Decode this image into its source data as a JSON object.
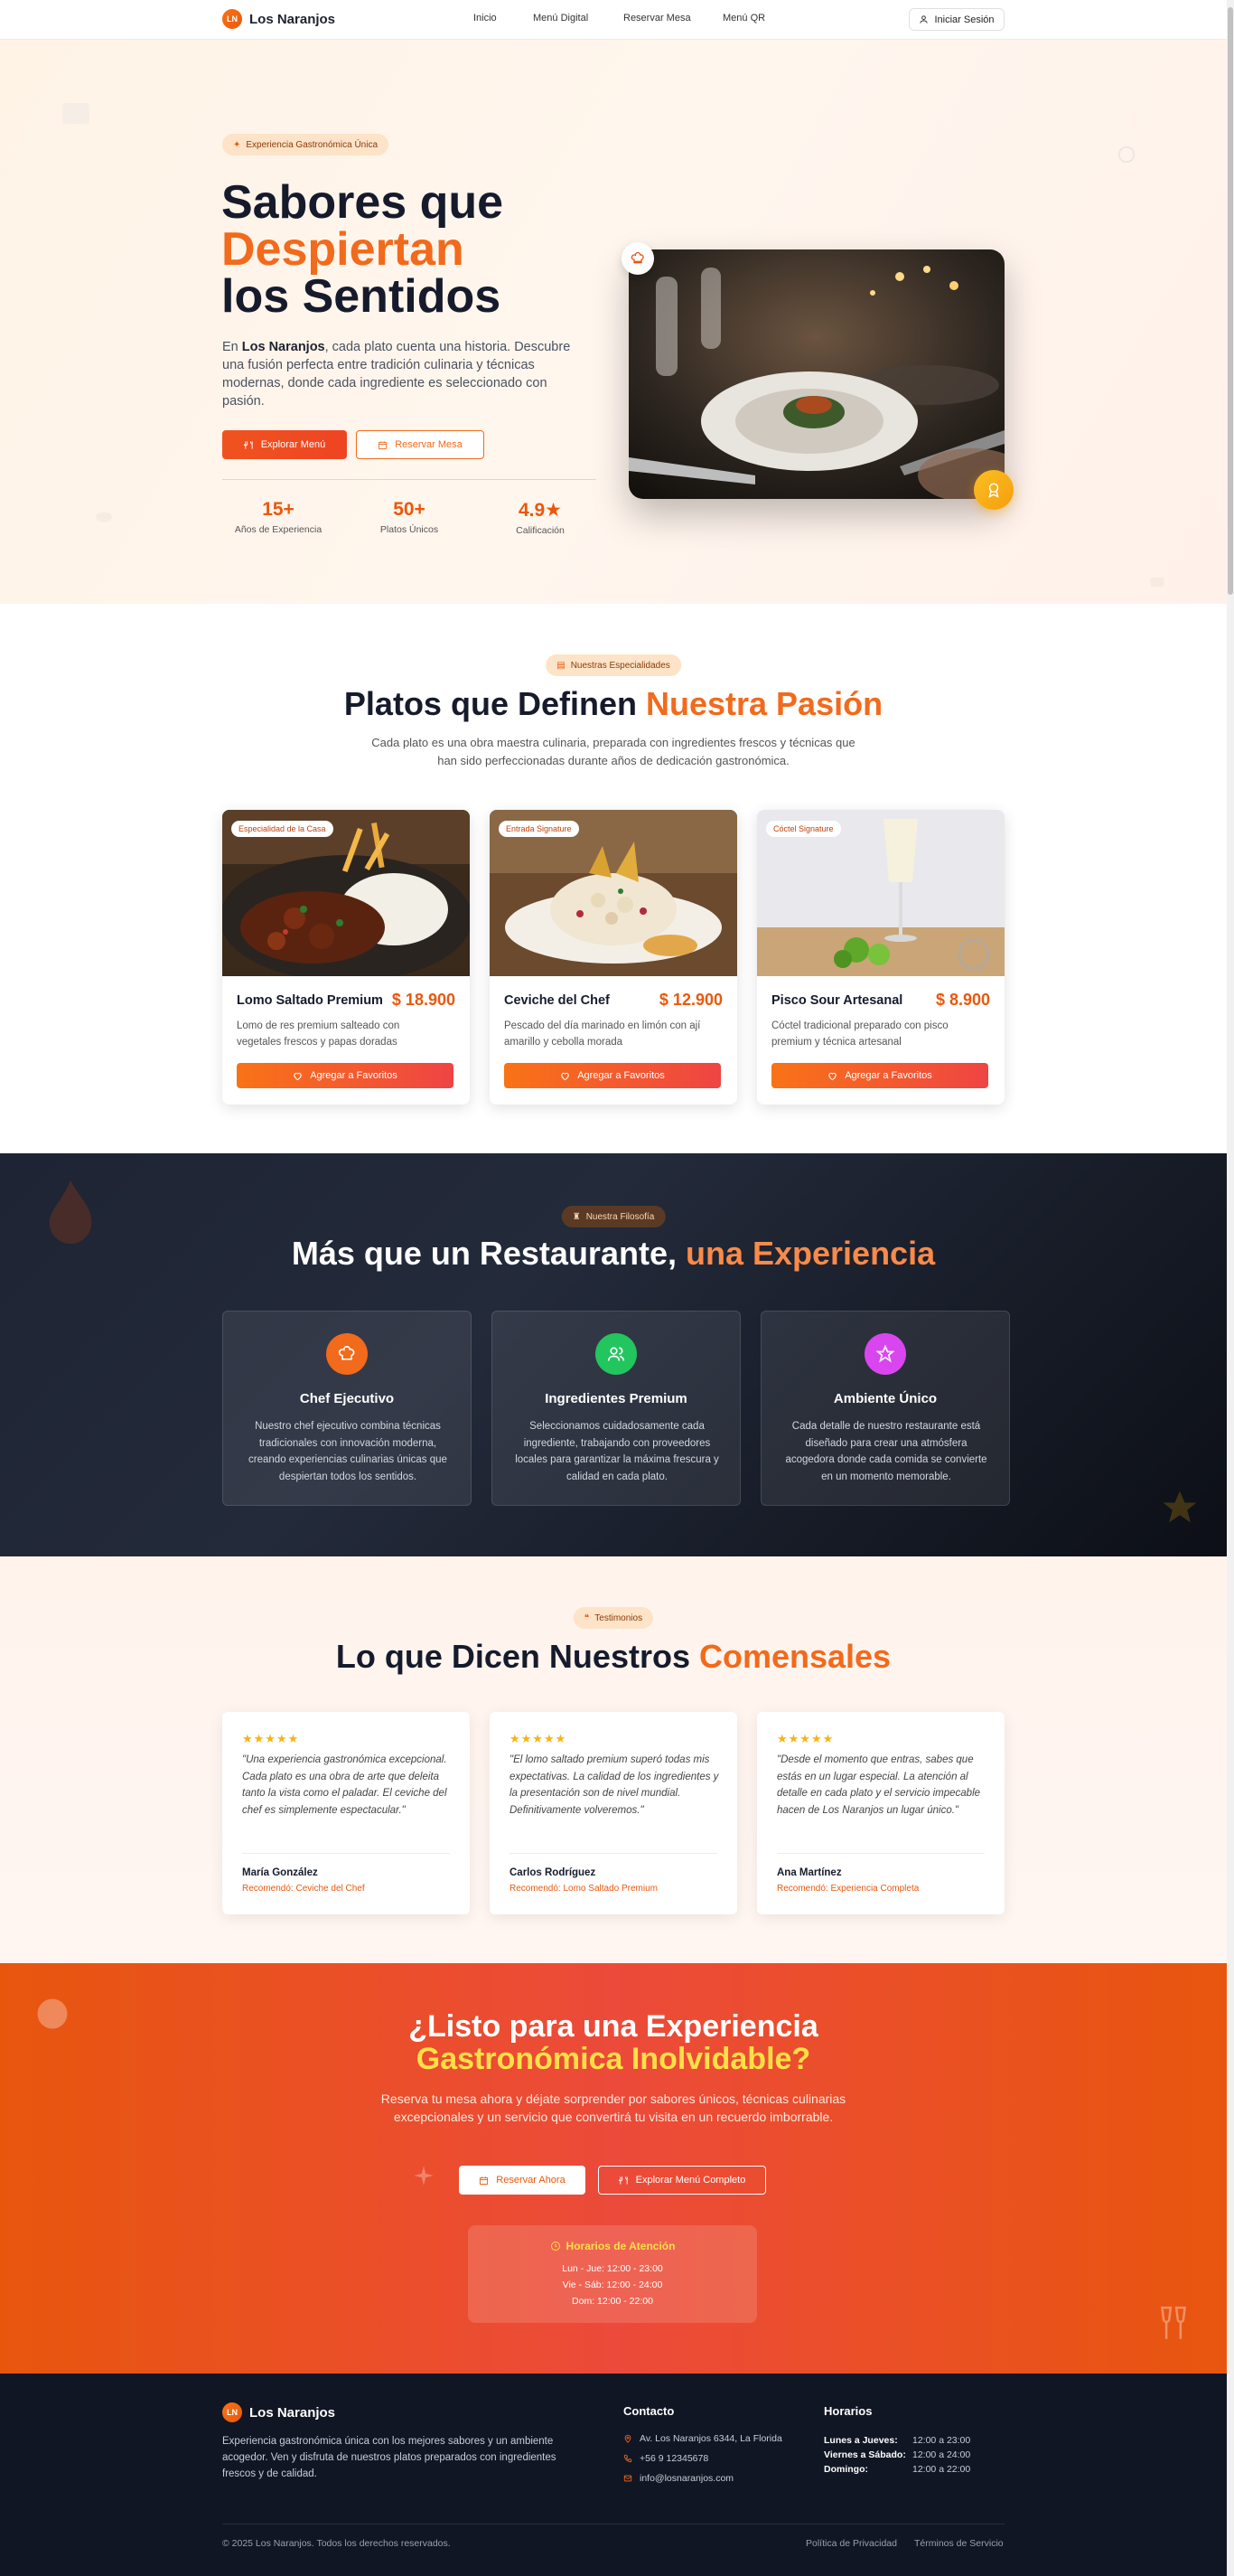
{
  "nav": {
    "logo_initials": "LN",
    "brand": "Los Naranjos",
    "links": [
      "Inicio",
      "Menú Digital",
      "Reservar Mesa",
      "Menú QR"
    ],
    "login": "Iniciar Sesión"
  },
  "hero": {
    "badge": "Experiencia Gastronómica Única",
    "title_line1": "Sabores que",
    "title_line2": "Despiertan",
    "title_line3": "los Sentidos",
    "desc_prefix": "En ",
    "desc_brand": "Los Naranjos",
    "desc_rest": ", cada plato cuenta una historia. Descubre una fusión perfecta entre tradición culinaria y técnicas modernas, donde cada ingrediente es seleccionado con pasión.",
    "btn_menu": "Explorar Menú",
    "btn_reserve": "Reservar Mesa",
    "stats": [
      {
        "num": "15+",
        "label": "Años de Experiencia"
      },
      {
        "num": "50+",
        "label": "Platos Únicos"
      },
      {
        "num": "4.9★",
        "label": "Calificación"
      }
    ]
  },
  "specialties": {
    "badge": "Nuestras Especialidades",
    "title_main": "Platos que Definen ",
    "title_accent": "Nuestra Pasión",
    "subtitle": "Cada plato es una obra maestra culinaria, preparada con ingredientes frescos y técnicas que han sido perfeccionadas durante años de dedicación gastronómica.",
    "dishes": [
      {
        "tag": "Especialidad de la Casa",
        "name": "Lomo Saltado Premium",
        "price": "$ 18.900",
        "desc": "Lomo de res premium salteado con vegetales frescos y papas doradas",
        "button": "Agregar a Favoritos"
      },
      {
        "tag": "Entrada Signature",
        "name": "Ceviche del Chef",
        "price": "$ 12.900",
        "desc": "Pescado del día marinado en limón con ají amarillo y cebolla morada",
        "button": "Agregar a Favoritos"
      },
      {
        "tag": "Cóctel Signature",
        "name": "Pisco Sour Artesanal",
        "price": "$ 8.900",
        "desc": "Cóctel tradicional preparado con pisco premium y técnica artesanal",
        "button": "Agregar a Favoritos"
      }
    ]
  },
  "philosophy": {
    "badge": "Nuestra Filosofía",
    "title_main": "Más que un Restaurante, ",
    "title_accent": "una Experiencia",
    "cards": [
      {
        "icon": "chef-hat-icon",
        "color": "#f26a1b",
        "title": "Chef Ejecutivo",
        "text": "Nuestro chef ejecutivo combina técnicas tradicionales con innovación moderna, creando experiencias culinarias únicas que despiertan todos los sentidos."
      },
      {
        "icon": "users-icon",
        "color": "#22c55e",
        "title": "Ingredientes Premium",
        "text": "Seleccionamos cuidadosamente cada ingrediente, trabajando con proveedores locales para garantizar la máxima frescura y calidad en cada plato."
      },
      {
        "icon": "star-icon",
        "color": "#d946ef",
        "title": "Ambiente Único",
        "text": "Cada detalle de nuestro restaurante está diseñado para crear una atmósfera acogedora donde cada comida se convierte en un momento memorable."
      }
    ]
  },
  "testimonials": {
    "badge": "Testimonios",
    "title_main": "Lo que Dicen Nuestros ",
    "title_accent": "Comensales",
    "stars": "★★★★★",
    "items": [
      {
        "quote": "\"Una experiencia gastronómica excepcional. Cada plato es una obra de arte que deleita tanto la vista como el paladar. El ceviche del chef es simplemente espectacular.\"",
        "name": "María González",
        "rec": "Recomendó: Ceviche del Chef"
      },
      {
        "quote": "\"El lomo saltado premium superó todas mis expectativas. La calidad de los ingredientes y la presentación son de nivel mundial. Definitivamente volveremos.\"",
        "name": "Carlos Rodríguez",
        "rec": "Recomendó: Lomo Saltado Premium"
      },
      {
        "quote": "\"Desde el momento que entras, sabes que estás en un lugar especial. La atención al detalle en cada plato y el servicio impecable hacen de Los Naranjos un lugar único.\"",
        "name": "Ana Martínez",
        "rec": "Recomendó: Experiencia Completa"
      }
    ]
  },
  "cta": {
    "title_line1": "¿Listo para una Experiencia",
    "title_line2": "Gastronómica Inolvidable?",
    "subtitle": "Reserva tu mesa ahora y déjate sorprender por sabores únicos, técnicas culinarias excepcionales y un servicio que convertirá tu visita en un recuerdo imborrable.",
    "btn_reserve": "Reservar Ahora",
    "btn_menu": "Explorar Menú Completo",
    "hours_title": "Horarios de Atención",
    "hours": [
      "Lun - Jue: 12:00 - 23:00",
      "Vie - Sáb: 12:00 - 24:00",
      "Dom: 12:00 - 22:00"
    ]
  },
  "footer": {
    "logo_initials": "LN",
    "brand": "Los Naranjos",
    "desc": "Experiencia gastronómica única con los mejores sabores y un ambiente acogedor. Ven y disfruta de nuestros platos preparados con ingredientes frescos y de calidad.",
    "contact_title": "Contacto",
    "address": "Av. Los Naranjos 6344, La Florida",
    "phone": "+56 9 12345678",
    "email": "info@losnaranjos.com",
    "hours_title": "Horarios",
    "hours": [
      {
        "day": "Lunes a Jueves:",
        "time": "12:00 a 23:00"
      },
      {
        "day": "Viernes a Sábado:",
        "time": "12:00 a 24:00"
      },
      {
        "day": "Domingo:",
        "time": "12:00 a 22:00"
      }
    ],
    "copyright": "© 2025 Los Naranjos. Todos los derechos reservados.",
    "privacy": "Política de Privacidad",
    "terms": "Términos de Servicio"
  },
  "colors": {
    "accent": "#f26a1b",
    "dark": "#161b2c",
    "cta": "#e8560e",
    "gold": "#fde047"
  }
}
